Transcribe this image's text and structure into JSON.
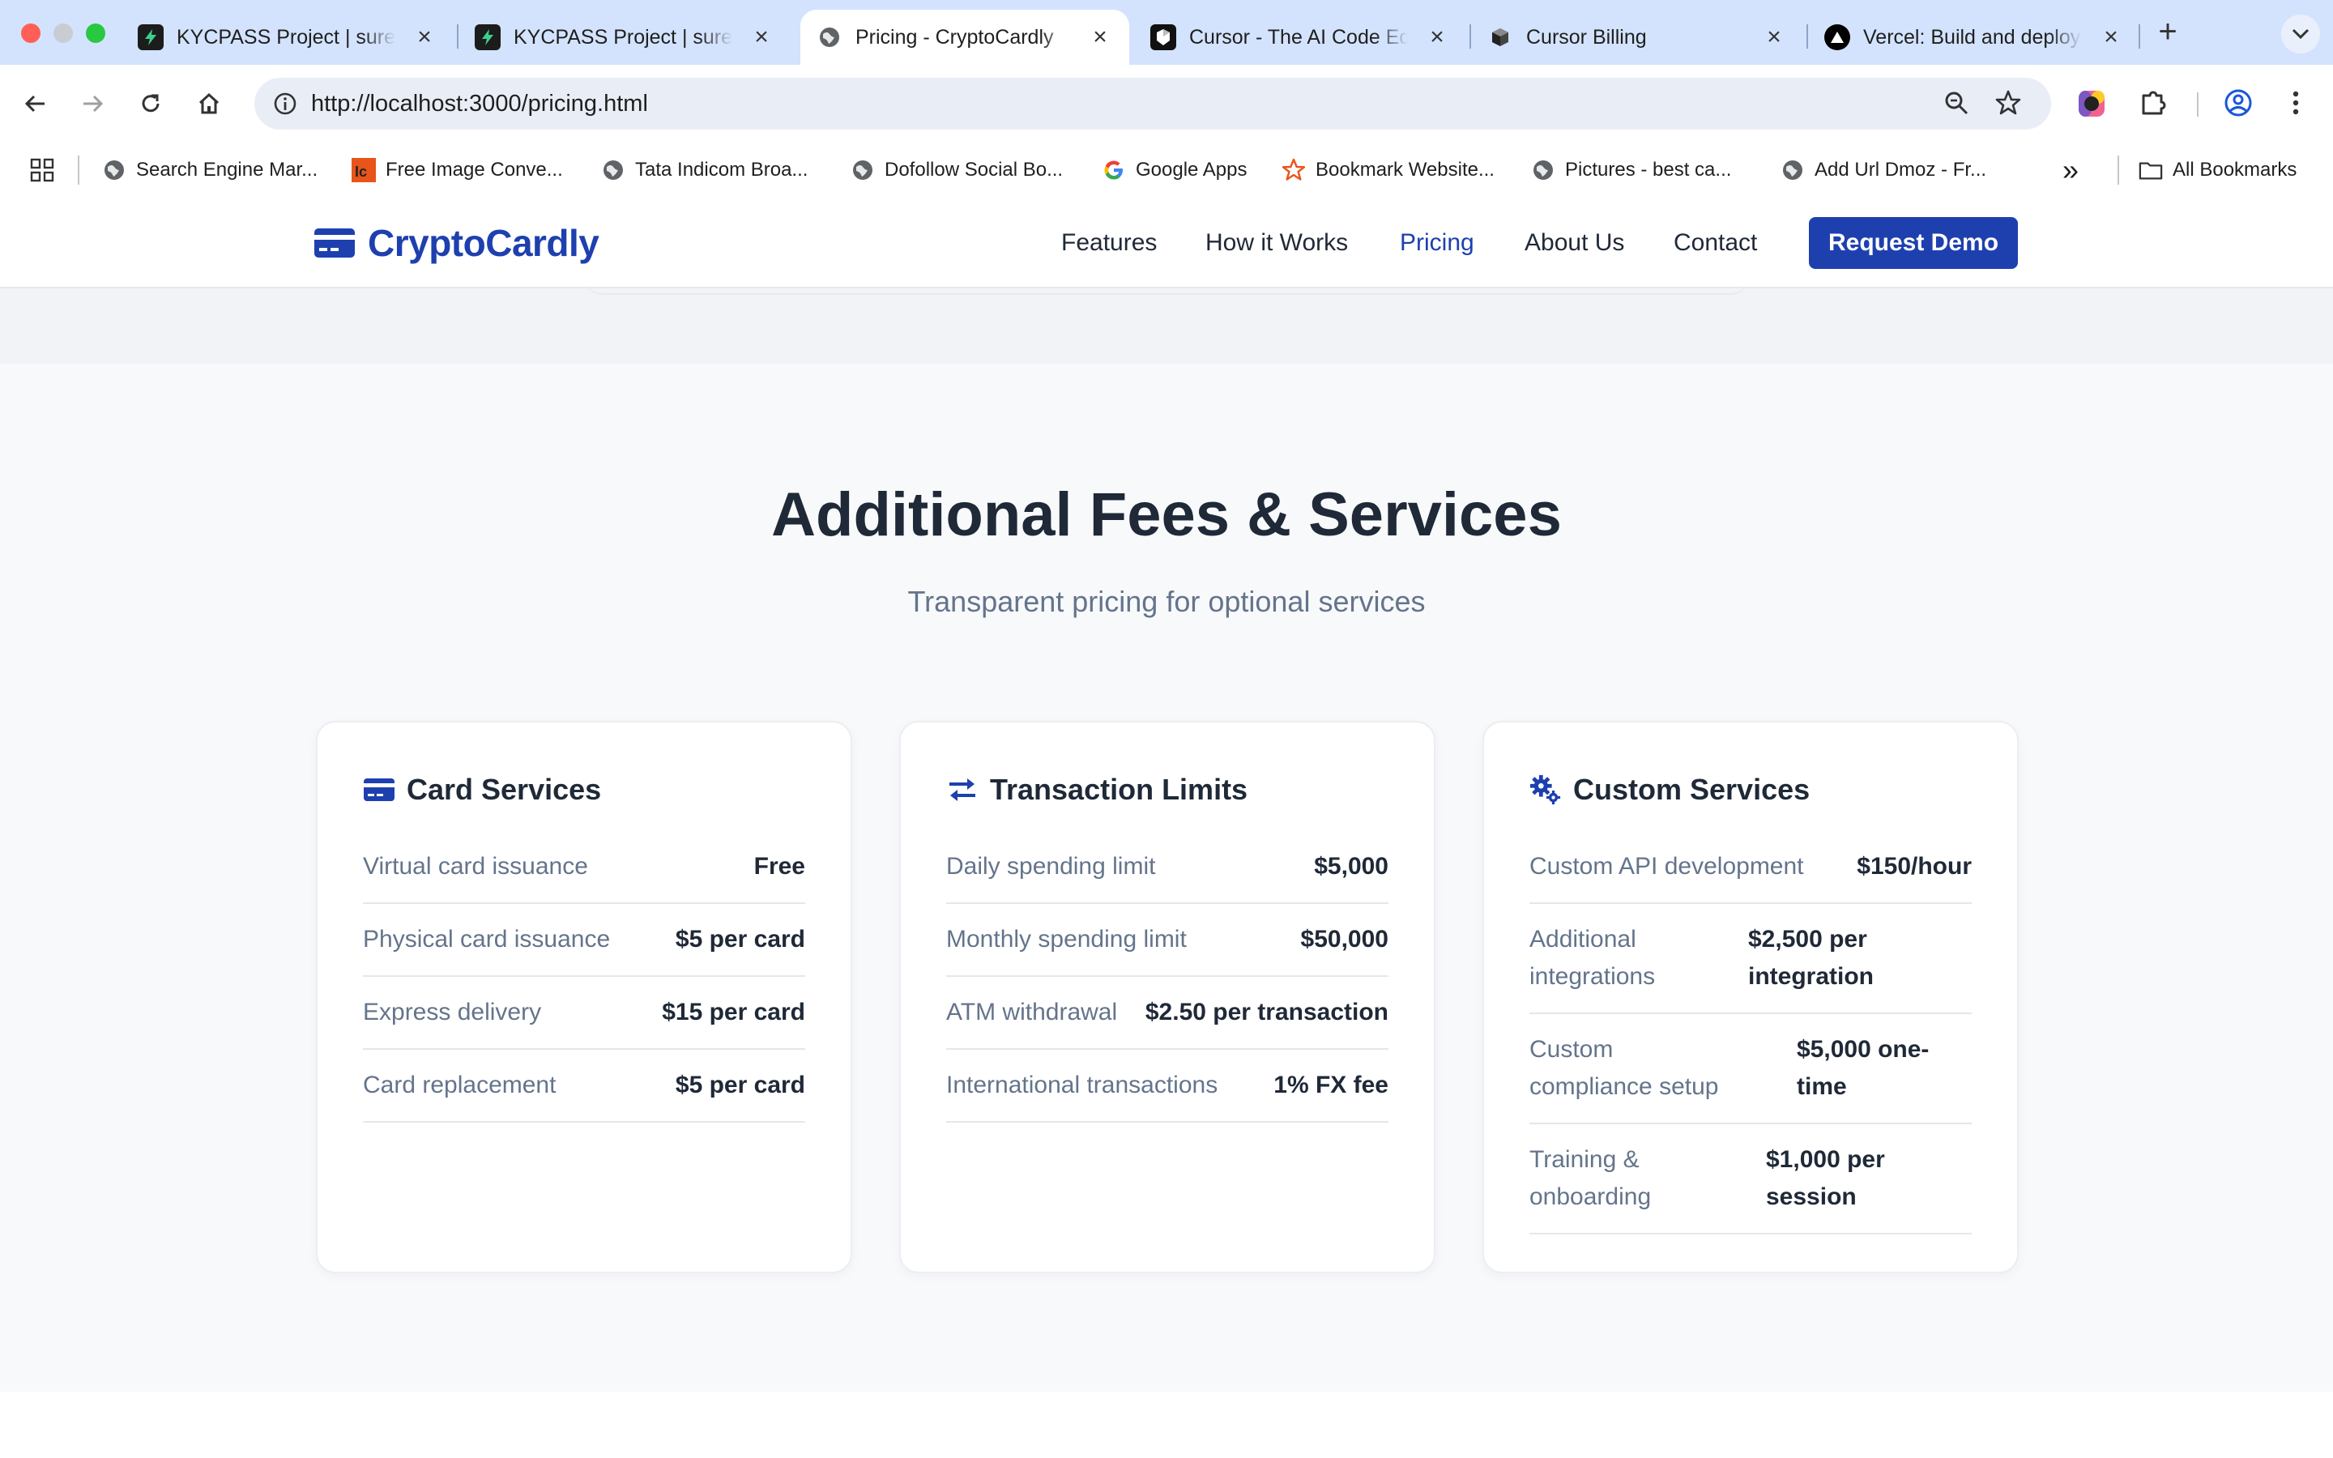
{
  "browser": {
    "tabs": [
      {
        "title": "KYCPASS Project | sures",
        "icon": "bolt-favicon",
        "active": false
      },
      {
        "title": "KYCPASS Project | sures",
        "icon": "bolt-favicon",
        "active": false
      },
      {
        "title": "Pricing - CryptoCardly",
        "icon": "globe-favicon",
        "active": true
      },
      {
        "title": "Cursor - The AI Code Ed",
        "icon": "cursor-favicon",
        "active": false
      },
      {
        "title": "Cursor Billing",
        "icon": "cube-favicon",
        "active": false
      },
      {
        "title": "Vercel: Build and deploy",
        "icon": "vercel-favicon",
        "active": false
      }
    ],
    "close_glyph": "×",
    "new_tab_glyph": "+",
    "url": "http://localhost:3000/pricing.html",
    "bookmarks": [
      {
        "label": "Search Engine Mar...",
        "icon": "globe-icon"
      },
      {
        "label": "Free Image Conve...",
        "icon": "ic-logo-icon"
      },
      {
        "label": "Tata Indicom Broa...",
        "icon": "globe-icon"
      },
      {
        "label": "Dofollow Social Bo...",
        "icon": "globe-icon"
      },
      {
        "label": "Google Apps",
        "icon": "google-icon"
      },
      {
        "label": "Bookmark Website...",
        "icon": "star-outline-icon"
      },
      {
        "label": "Pictures - best ca...",
        "icon": "globe-icon"
      },
      {
        "label": "Add Url Dmoz - Fr...",
        "icon": "globe-icon"
      }
    ],
    "bookmarks_overflow": "»",
    "all_bookmarks": "All Bookmarks"
  },
  "site": {
    "logo_text": "CryptoCardly",
    "nav": {
      "features": "Features",
      "how": "How it Works",
      "pricing": "Pricing",
      "about": "About Us",
      "contact": "Contact",
      "cta": "Request Demo"
    },
    "colors": {
      "brand": "#1e40af",
      "heading": "#1f2937",
      "muted": "#64748b"
    }
  },
  "section": {
    "title": "Additional Fees & Services",
    "subtitle": "Transparent pricing for optional services",
    "cards": [
      {
        "title": "Card Services",
        "icon": "credit-card-icon",
        "rows": [
          {
            "label": "Virtual card issuance",
            "value": "Free"
          },
          {
            "label": "Physical card issuance",
            "value": "$5 per card"
          },
          {
            "label": "Express delivery",
            "value": "$15 per card"
          },
          {
            "label": "Card replacement",
            "value": "$5 per card"
          }
        ]
      },
      {
        "title": "Transaction Limits",
        "icon": "exchange-arrows-icon",
        "rows": [
          {
            "label": "Daily spending limit",
            "value": "$5,000"
          },
          {
            "label": "Monthly spending limit",
            "value": "$50,000"
          },
          {
            "label": "ATM withdrawal",
            "value": "$2.50 per transaction"
          },
          {
            "label": "International transactions",
            "value": "1% FX fee"
          }
        ]
      },
      {
        "title": "Custom Services",
        "icon": "gears-icon",
        "rows": [
          {
            "label": "Custom API development",
            "value": "$150/hour"
          },
          {
            "label": "Additional integrations",
            "value": "$2,500 per integration"
          },
          {
            "label": "Custom compliance setup",
            "value": "$5,000 one-time"
          },
          {
            "label": "Training & onboarding",
            "value": "$1,000 per session"
          }
        ]
      }
    ]
  }
}
